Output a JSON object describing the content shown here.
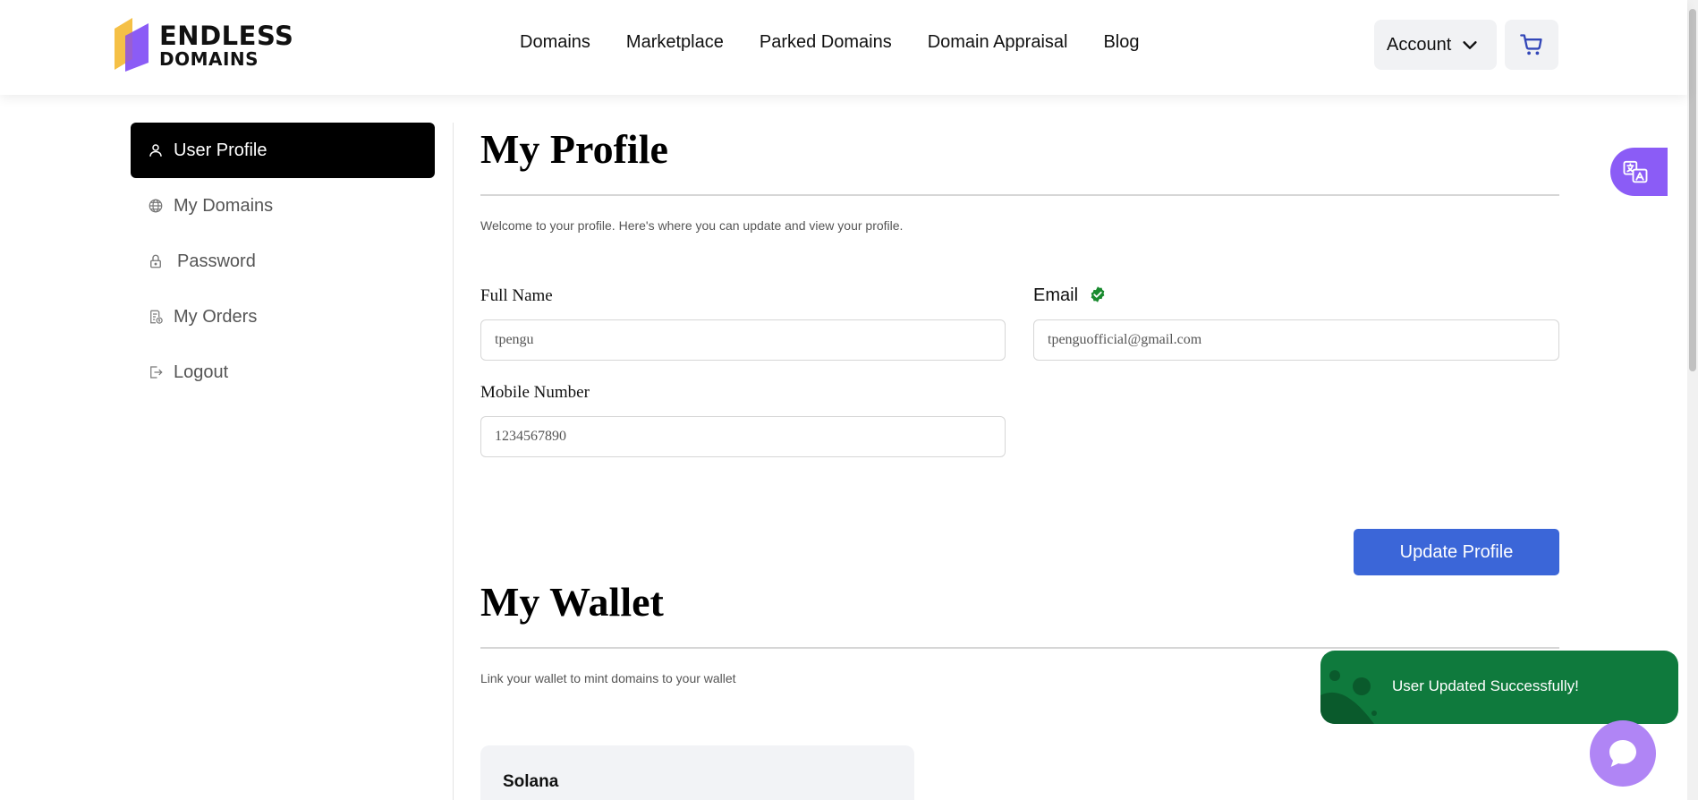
{
  "header": {
    "logo": {
      "line1": "ENDLESS",
      "line2": "DOMAINS"
    },
    "nav": [
      "Domains",
      "Marketplace",
      "Parked Domains",
      "Domain Appraisal",
      "Blog"
    ],
    "account_label": "Account",
    "cart_icon": "cart-icon"
  },
  "sidebar": {
    "items": [
      {
        "label": "User Profile",
        "icon": "user-icon",
        "active": true
      },
      {
        "label": "My Domains",
        "icon": "globe-icon"
      },
      {
        "label": "Password",
        "icon": "lock-icon"
      },
      {
        "label": "My Orders",
        "icon": "receipt-icon"
      },
      {
        "label": "Logout",
        "icon": "logout-icon"
      }
    ]
  },
  "profile": {
    "title": "My Profile",
    "subtitle": "Welcome to your profile. Here's where you can update and view your profile.",
    "full_name_label": "Full Name",
    "full_name_value": "tpengu",
    "email_label": "Email",
    "email_value": "tpenguofficial@gmail.com",
    "mobile_label": "Mobile Number",
    "mobile_value": "1234567890",
    "update_button": "Update Profile"
  },
  "wallet": {
    "title": "My Wallet",
    "subtitle": "Link your wallet to mint domains to your wallet",
    "card_title": "Solana"
  },
  "toast": {
    "message": "User Updated Successfully!"
  },
  "colors": {
    "primary_button": "#3b66d8",
    "toast_bg": "#0f7a3d",
    "translate_bg": "#8b5cf6",
    "chat_bg": "#b085f5",
    "verified": "#188a2e"
  }
}
